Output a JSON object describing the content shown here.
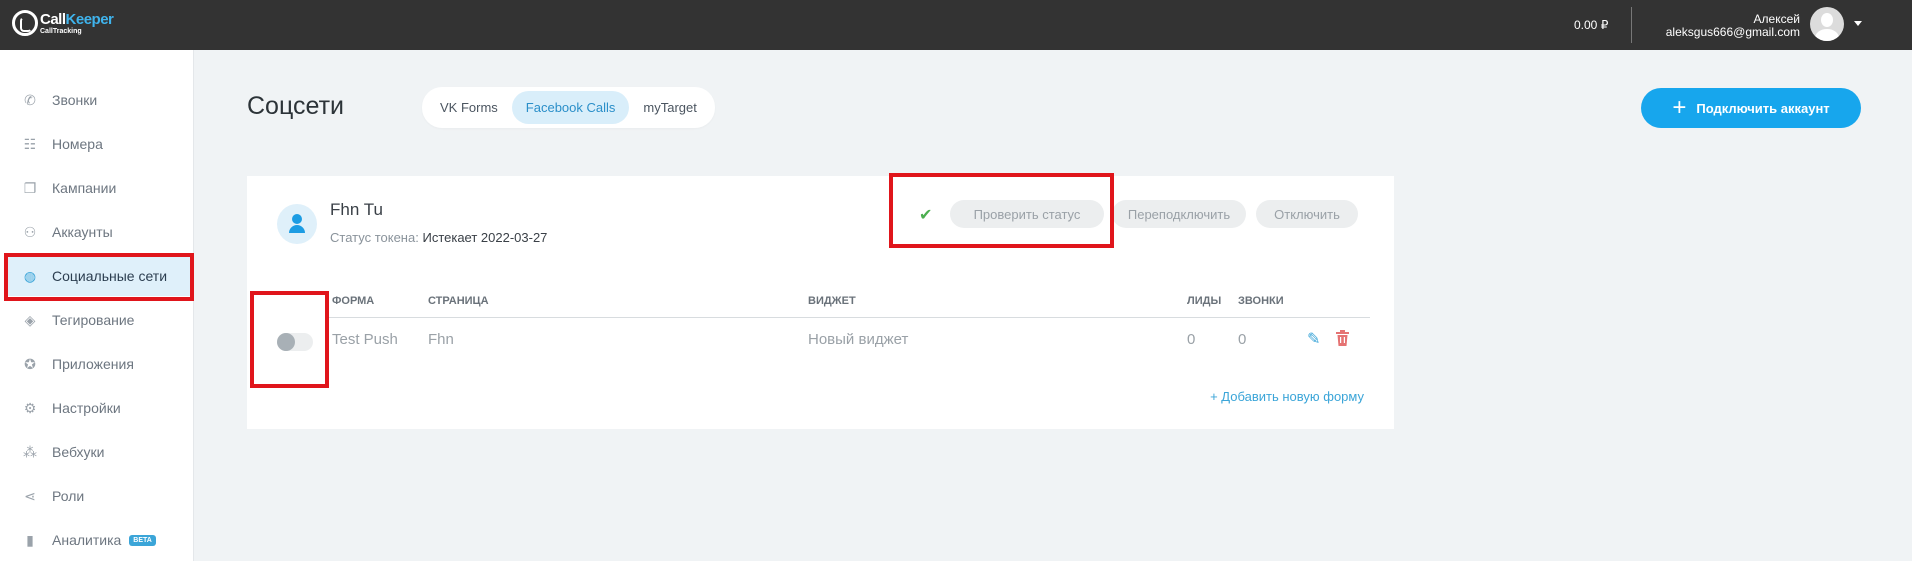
{
  "header": {
    "logo_name_1": "Call",
    "logo_name_2": "Keeper",
    "logo_sub": "CallTracking",
    "balance": "0.00 ₽",
    "user_name": "Алексей",
    "user_email": "aleksgus666@gmail.com"
  },
  "sidebar": {
    "items": [
      {
        "label": "Звонки",
        "icon": "phone-icon",
        "glyph": "✆"
      },
      {
        "label": "Номера",
        "icon": "numbers-icon",
        "glyph": "☷"
      },
      {
        "label": "Кампании",
        "icon": "campaigns-icon",
        "glyph": "❐"
      },
      {
        "label": "Аккаунты",
        "icon": "accounts-icon",
        "glyph": "⚇"
      },
      {
        "label": "Социальные сети",
        "icon": "globe-icon",
        "glyph": "◍"
      },
      {
        "label": "Тегирование",
        "icon": "tags-icon",
        "glyph": "◈"
      },
      {
        "label": "Приложения",
        "icon": "apps-icon",
        "glyph": "✪"
      },
      {
        "label": "Настройки",
        "icon": "gear-icon",
        "glyph": "⚙"
      },
      {
        "label": "Вебхуки",
        "icon": "webhooks-icon",
        "glyph": "⁂"
      },
      {
        "label": "Роли",
        "icon": "share-icon",
        "glyph": "⋖"
      },
      {
        "label": "Аналитика",
        "icon": "chart-icon",
        "glyph": "▮",
        "badge": "BETA"
      }
    ],
    "active_index": 4
  },
  "main": {
    "title": "Соцсети",
    "tabs": [
      {
        "label": "VK Forms"
      },
      {
        "label": "Facebook Calls"
      },
      {
        "label": "myTarget"
      }
    ],
    "active_tab": 1,
    "connect_label": "Подключить аккаунт"
  },
  "account": {
    "name": "Fhn Tu",
    "token_label": "Статус токена:",
    "token_value": "Истекает 2022-03-27",
    "check_status": "Проверить статус",
    "reconnect": "Переподключить",
    "disconnect": "Отключить"
  },
  "table": {
    "columns": [
      "ФОРМА",
      "СТРАНИЦА",
      "ВИДЖЕТ",
      "ЛИДЫ",
      "ЗВОНКИ"
    ],
    "rows": [
      {
        "enabled": false,
        "form": "Test Push",
        "page": "Fhn",
        "widget": "Новый виджет",
        "leads": "0",
        "calls": "0"
      }
    ],
    "add_form": "+ Добавить новую форму"
  },
  "colors": {
    "accent": "#17a6ed",
    "topbar": "#333333",
    "highlight": "#e0151b"
  }
}
